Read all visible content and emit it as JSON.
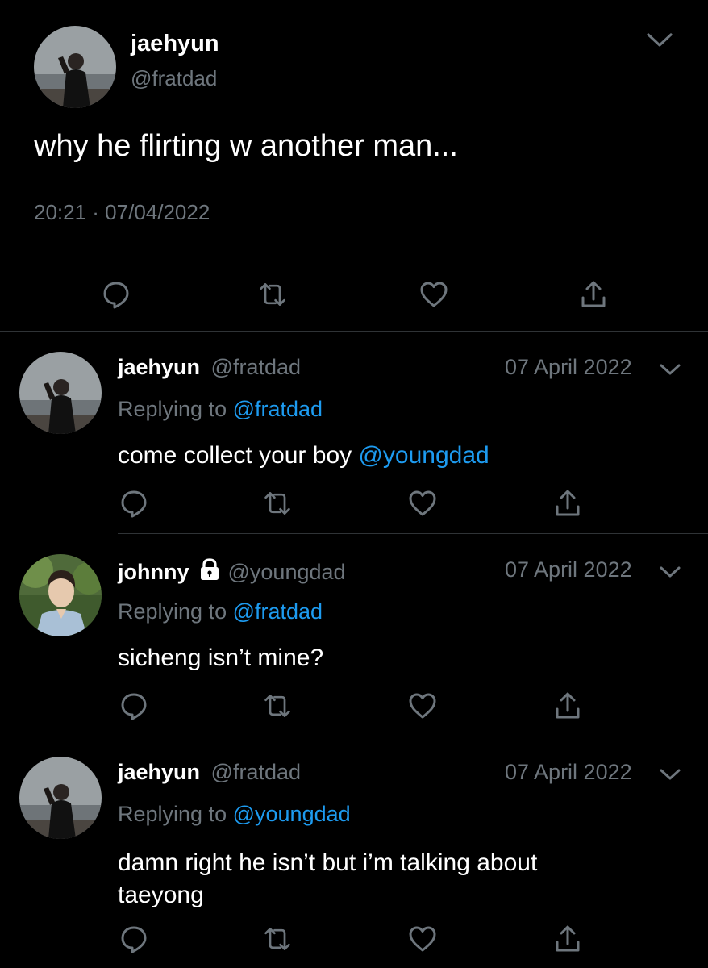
{
  "main_tweet": {
    "name": "jaehyun",
    "handle": "@fratdad",
    "text": "why he flirting w another man...",
    "timestamp": "20:21 · 07/04/2022"
  },
  "replies": [
    {
      "name": "jaehyun",
      "handle": "@fratdad",
      "date": "07 April 2022",
      "replying_prefix": "Replying to",
      "replying_to": "@fratdad",
      "text_plain": "come collect your boy ",
      "text_mention": "@youngdad"
    },
    {
      "name": "johnny",
      "handle": "@youngdad",
      "date": "07 April 2022",
      "replying_prefix": "Replying to",
      "replying_to": "@fratdad",
      "text_plain": "sicheng isn’t mine?"
    },
    {
      "name": "jaehyun",
      "handle": "@fratdad",
      "date": "07 April 2022",
      "replying_prefix": "Replying to",
      "replying_to": "@youngdad",
      "text_line1": "damn right he isn’t but i’m talking about",
      "text_line2": "taeyong"
    }
  ],
  "colors": {
    "background": "#000000",
    "text": "#ffffff",
    "muted": "#6e767d",
    "link": "#1d9bf0",
    "divider": "#2f3336"
  },
  "icons": [
    "chevron-down-icon",
    "reply-icon",
    "retweet-icon",
    "like-icon",
    "share-icon",
    "lock-icon"
  ]
}
